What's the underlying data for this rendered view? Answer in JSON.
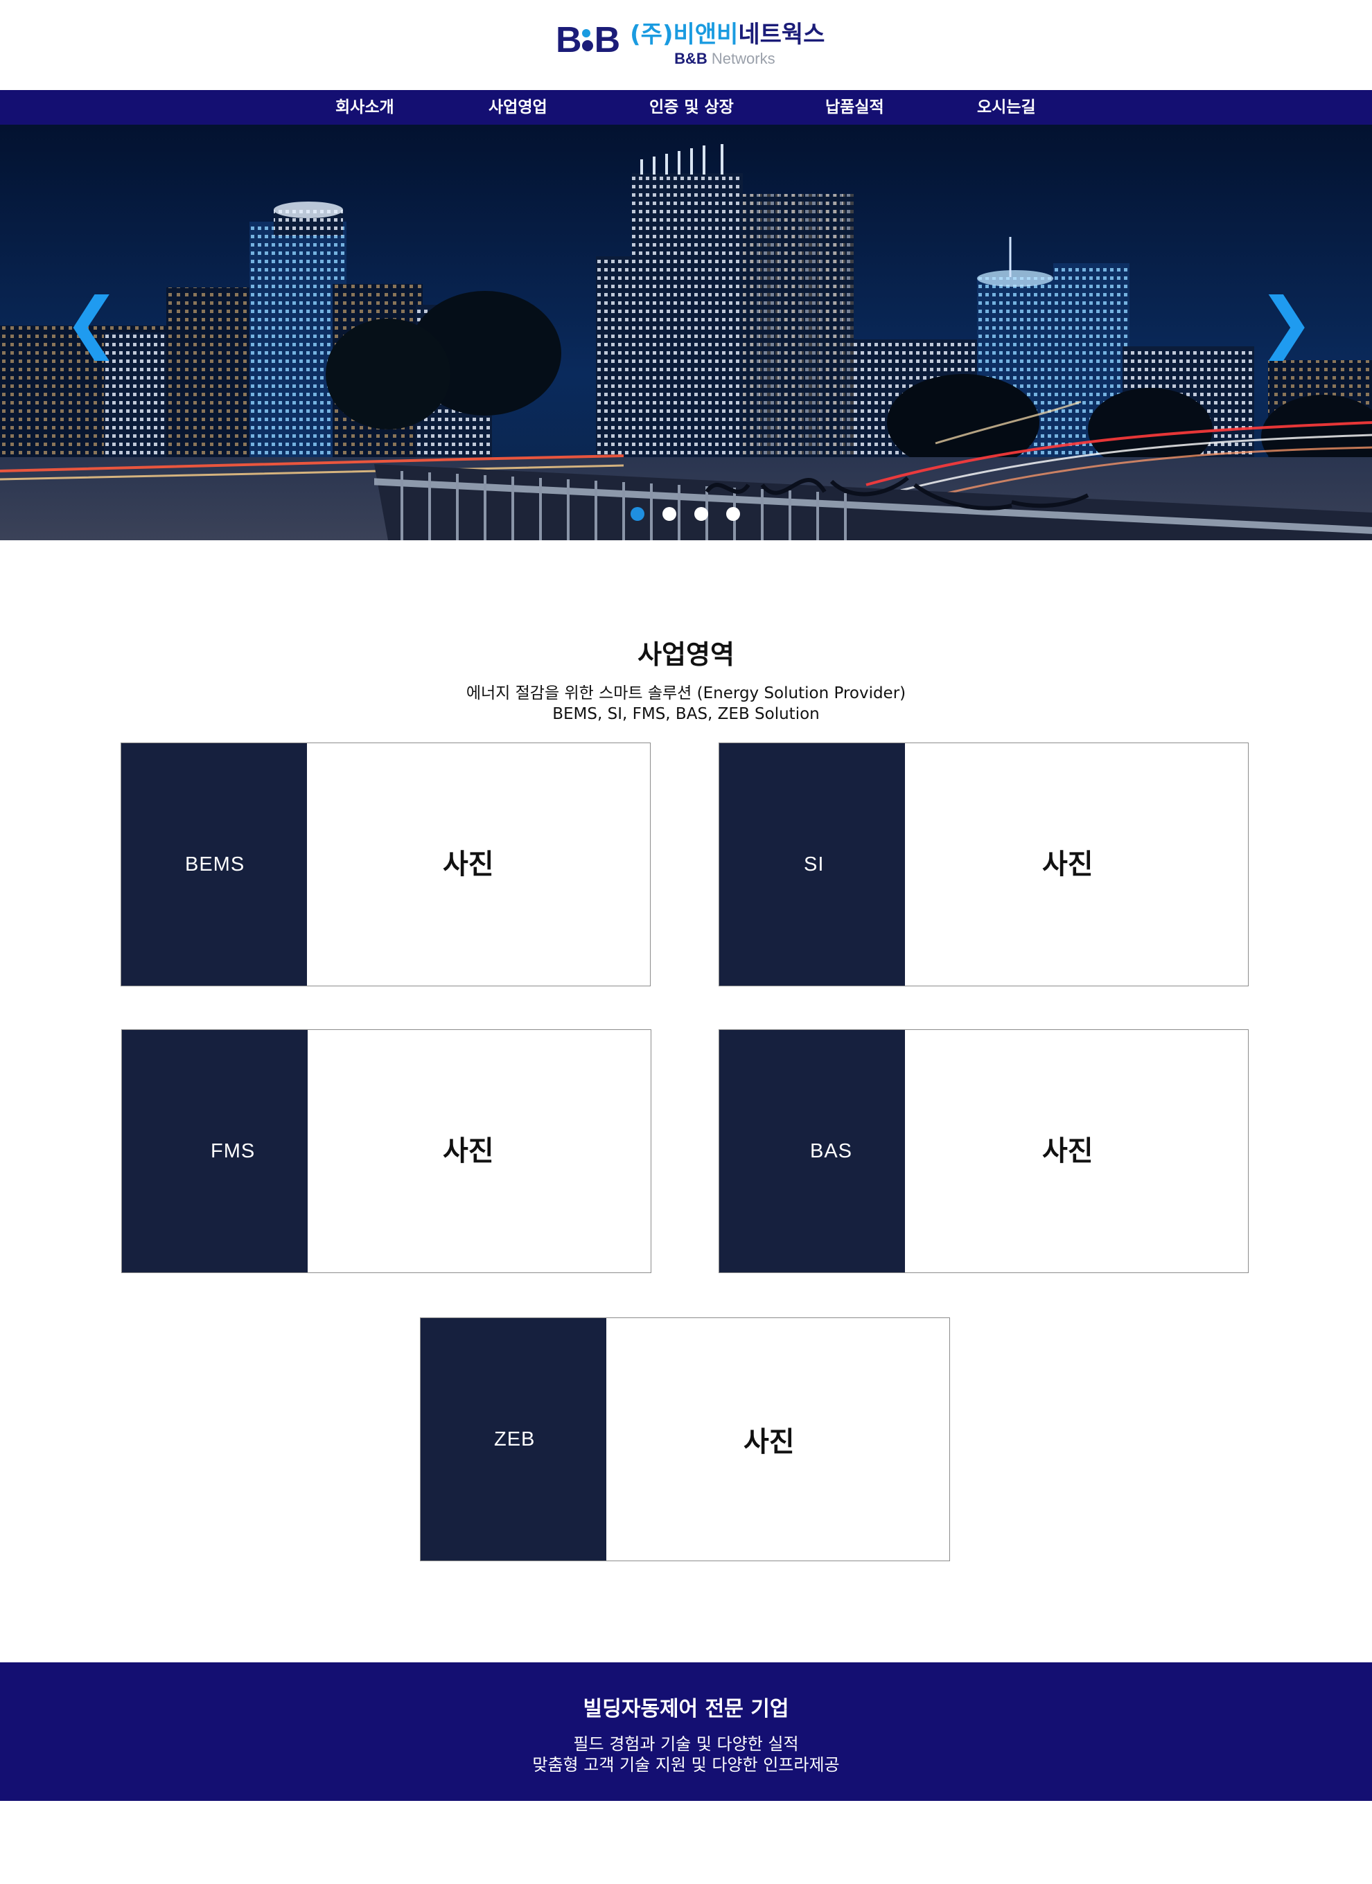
{
  "header": {
    "logo_mark_left": "B",
    "logo_mark_right": "B",
    "logo_korean_prefix": "(주)비앤비",
    "logo_korean_suffix": "네트웍스",
    "logo_sub_bb": "B&B",
    "logo_sub_networks": "Networks"
  },
  "nav": {
    "items": [
      "회사소개",
      "사업영업",
      "인증 및 상장",
      "납품실적",
      "오시는길"
    ]
  },
  "hero": {
    "prev_arrow": "❮",
    "next_arrow": "❯",
    "slide_count": 4,
    "active_slide": 1
  },
  "business": {
    "title": "사업영역",
    "desc_line1": "에너지 절감을 위한 스마트 솔루션 (Energy Solution Provider)",
    "desc_line2": "BEMS, SI, FMS, BAS, ZEB Solution",
    "cards": [
      {
        "label": "BEMS",
        "photo": "사진"
      },
      {
        "label": "SI",
        "photo": "사진"
      },
      {
        "label": "FMS",
        "photo": "사진"
      },
      {
        "label": "BAS",
        "photo": "사진"
      },
      {
        "label": "ZEB",
        "photo": "사진"
      }
    ]
  },
  "footer": {
    "title": "빌딩자동제어 전문 기업",
    "line1": "필드 경험과 기술 및 다양한 실적",
    "line2": "맞춤형 고객 기술 지원 및 다양한 인프라제공"
  },
  "colors": {
    "nav_bg": "#140f72",
    "card_panel": "#16203e",
    "accent_blue": "#1a9be0",
    "brand_navy": "#1b1c78"
  }
}
